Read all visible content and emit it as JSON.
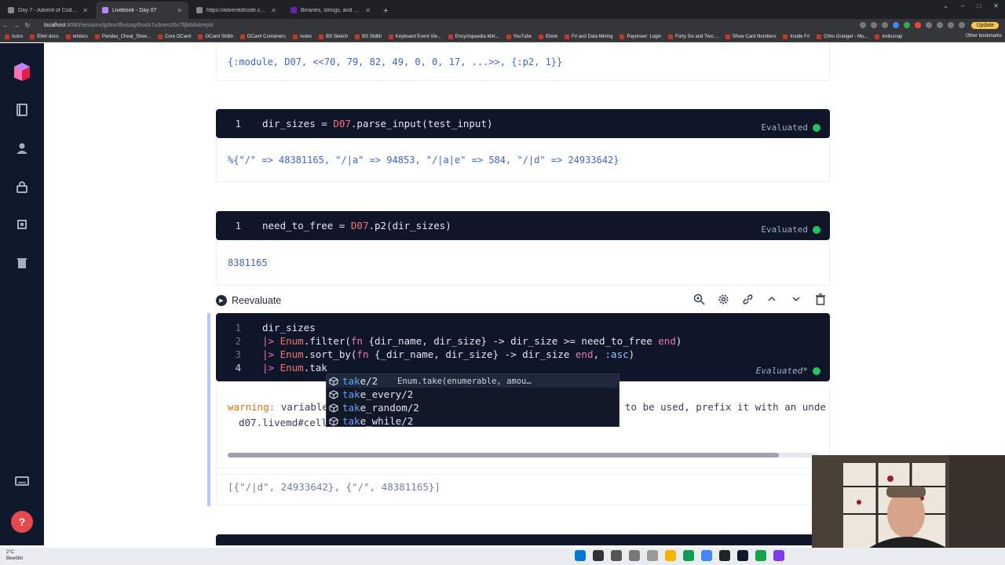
{
  "browser": {
    "tabs": [
      {
        "title": "Day 7 - Advent of Code 2022",
        "active": false
      },
      {
        "title": "Livebook - Day 07",
        "active": true
      },
      {
        "title": "https://adventofcode.com/2022/...",
        "active": false
      },
      {
        "title": "Binaries, strings, and charlists - T",
        "active": false
      }
    ],
    "url_host": "localhost",
    "url_rest": ":8080/sessions/jp5nx3fivszayi5oslx7u3cem26x7lljb6dubreptz",
    "update_label": "Update",
    "bookmarks": [
      "Icons",
      "Elixir docs",
      "erldocs",
      "Pandas_Cheat_Shee...",
      "Core OCaml",
      "OCaml Stdlib",
      "OCaml Containers",
      "redex",
      "BS Sketch",
      "BS Stdlib",
      "Keyboard Event Vie...",
      "Encyclopaedia Met...",
      "YouTube",
      "Elixre",
      "F# and Data Mining",
      "Payoneer: Login",
      "Forty Six and Two:...",
      "Show Card Numbers",
      "Inside F#",
      "Chris Granger - Mu...",
      "trellosnap"
    ],
    "other_bookmarks": "Other bookmarks"
  },
  "notebook": {
    "output_module": "{:module, D07, <<70, 79, 82, 49, 0, 0, 17, ...>>, {:p2, 1}}",
    "cell1": {
      "line_number": "1",
      "var": "dir_sizes",
      "op": " = ",
      "mod": "D07",
      "rest": ".parse_input(test_input)",
      "status": "Evaluated"
    },
    "output1": "%{\"/\" => 48381165, \"/|a\" => 94853, \"/|a|e\" => 584, \"/|d\" => 24933642}",
    "cell2": {
      "line_number": "1",
      "var": "need_to_free",
      "op": " = ",
      "mod": "D07",
      "rest": ".p2(dir_sizes)",
      "status": "Evaluated"
    },
    "output2": "8381165",
    "toolbar": {
      "reevaluate_label": "Reevaluate"
    },
    "cell3": {
      "line_numbers": [
        "1",
        "2",
        "3",
        "4"
      ],
      "line1": "dir_sizes",
      "line2_pipe": "|> ",
      "line2_mod": "Enum",
      "line2_a": ".filter(",
      "line2_fn": "fn",
      "line2_b": " {dir_name, dir_size} -> dir_size >= need_to_free ",
      "line2_end": "end",
      "line2_c": ")",
      "line3_pipe": "|> ",
      "line3_mod": "Enum",
      "line3_a": ".sort_by(",
      "line3_fn": "fn",
      "line3_b": " {_dir_name, dir_size} -> dir_size ",
      "line3_end": "end",
      "line3_c": ", ",
      "line3_atom": ":asc",
      "line3_d": ")",
      "line4_pipe": "|> ",
      "line4_mod": "Enum",
      "line4_a": ".tak",
      "status": "Evaluated*"
    },
    "autocomplete": [
      {
        "match": "tak",
        "rest": "e/2",
        "detail": "Enum.take(enumerable, amou…"
      },
      {
        "match": "tak",
        "rest": "e_every/2",
        "detail": ""
      },
      {
        "match": "tak",
        "rest": "e_random/2",
        "detail": ""
      },
      {
        "match": "tak",
        "rest": "e_while/2",
        "detail": ""
      }
    ],
    "warning": {
      "label": "warning:",
      "text": " variable",
      "tail": "to be used, prefix it with an unde",
      "location": "d07.livemd#cell"
    },
    "result": "[{\"/|d\", 24933642}, {\"/\", 48381165}]"
  },
  "taskbar": {
    "temp": "2°C",
    "weather": "Bewölkt"
  },
  "colors": {
    "sidebar": "#0f172a",
    "editor_bg": "#0f1629",
    "evaluated_dot": "#22c55e",
    "help_button": "#e5484d"
  }
}
